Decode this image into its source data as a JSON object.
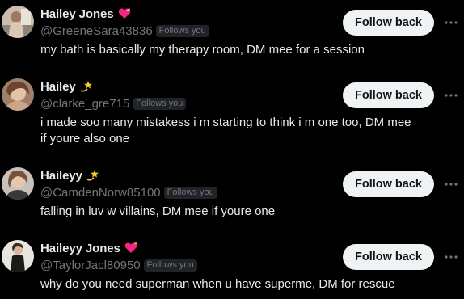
{
  "follow_list": [
    {
      "name": "Hailey Jones",
      "emoji": "heart-with-ribbon-icon",
      "handle": "@GreeneSara43836",
      "badge": "Follows you",
      "bio": "my bath is basically my therapy room, DM mee for a session",
      "button": "Follow back"
    },
    {
      "name": "Hailey",
      "emoji": "dizzy-star-icon",
      "handle": "@clarke_gre715",
      "badge": "Follows you",
      "bio": "i made soo many mistakess i m starting to think i m one too, DM mee if youre also one",
      "button": "Follow back"
    },
    {
      "name": "Haileyy",
      "emoji": "dizzy-star-icon",
      "handle": "@CamdenNorw85100",
      "badge": "Follows you",
      "bio": "falling in luv w villains, DM mee if youre one",
      "button": "Follow back"
    },
    {
      "name": "Haileyy Jones",
      "emoji": "sparkling-heart-icon",
      "handle": "@TaylorJacl80950",
      "badge": "Follows you",
      "bio": "why do you need superman when u have superme, DM for rescue",
      "button": "Follow back"
    }
  ],
  "colors": {
    "background": "#000000",
    "primary_text": "#e7e9ea",
    "secondary_text": "#71767b",
    "button_bg": "#eff3f4",
    "button_text": "#0f1419"
  }
}
